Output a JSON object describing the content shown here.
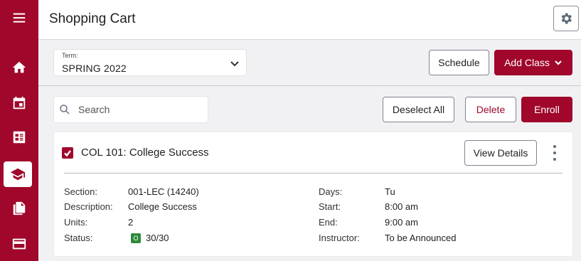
{
  "sidebar": {
    "items": [
      {
        "icon": "menu-icon"
      },
      {
        "icon": "home-icon"
      },
      {
        "icon": "calendar-icon"
      },
      {
        "icon": "list-icon"
      },
      {
        "icon": "graduation-cap-icon",
        "active": true
      },
      {
        "icon": "documents-icon"
      },
      {
        "icon": "credit-card-icon"
      }
    ]
  },
  "header": {
    "title": "Shopping Cart",
    "settings_icon": "gear-icon"
  },
  "term": {
    "label": "Term:",
    "value": "SPRING 2022"
  },
  "toolbar": {
    "schedule_label": "Schedule",
    "add_class_label": "Add Class",
    "deselect_all_label": "Deselect All",
    "delete_label": "Delete",
    "enroll_label": "Enroll"
  },
  "search": {
    "placeholder": "Search",
    "value": ""
  },
  "class_card": {
    "checked": true,
    "title": "COL 101: College Success",
    "view_details_label": "View Details",
    "left_fields": [
      {
        "label": "Section:",
        "value": "001-LEC (14240)"
      },
      {
        "label": "Description:",
        "value": "College Success"
      },
      {
        "label": "Units:",
        "value": "2"
      },
      {
        "label": "Status:",
        "value": "30/30",
        "badge": "O"
      }
    ],
    "right_fields": [
      {
        "label": "Days:",
        "value": "Tu"
      },
      {
        "label": "Start:",
        "value": "8:00 am"
      },
      {
        "label": "End:",
        "value": "9:00 am"
      },
      {
        "label": "Instructor:",
        "value": "To be Announced"
      }
    ]
  },
  "colors": {
    "brand": "#a0072b",
    "status_open": "#2e8b3a",
    "background": "#f1f1f3"
  }
}
